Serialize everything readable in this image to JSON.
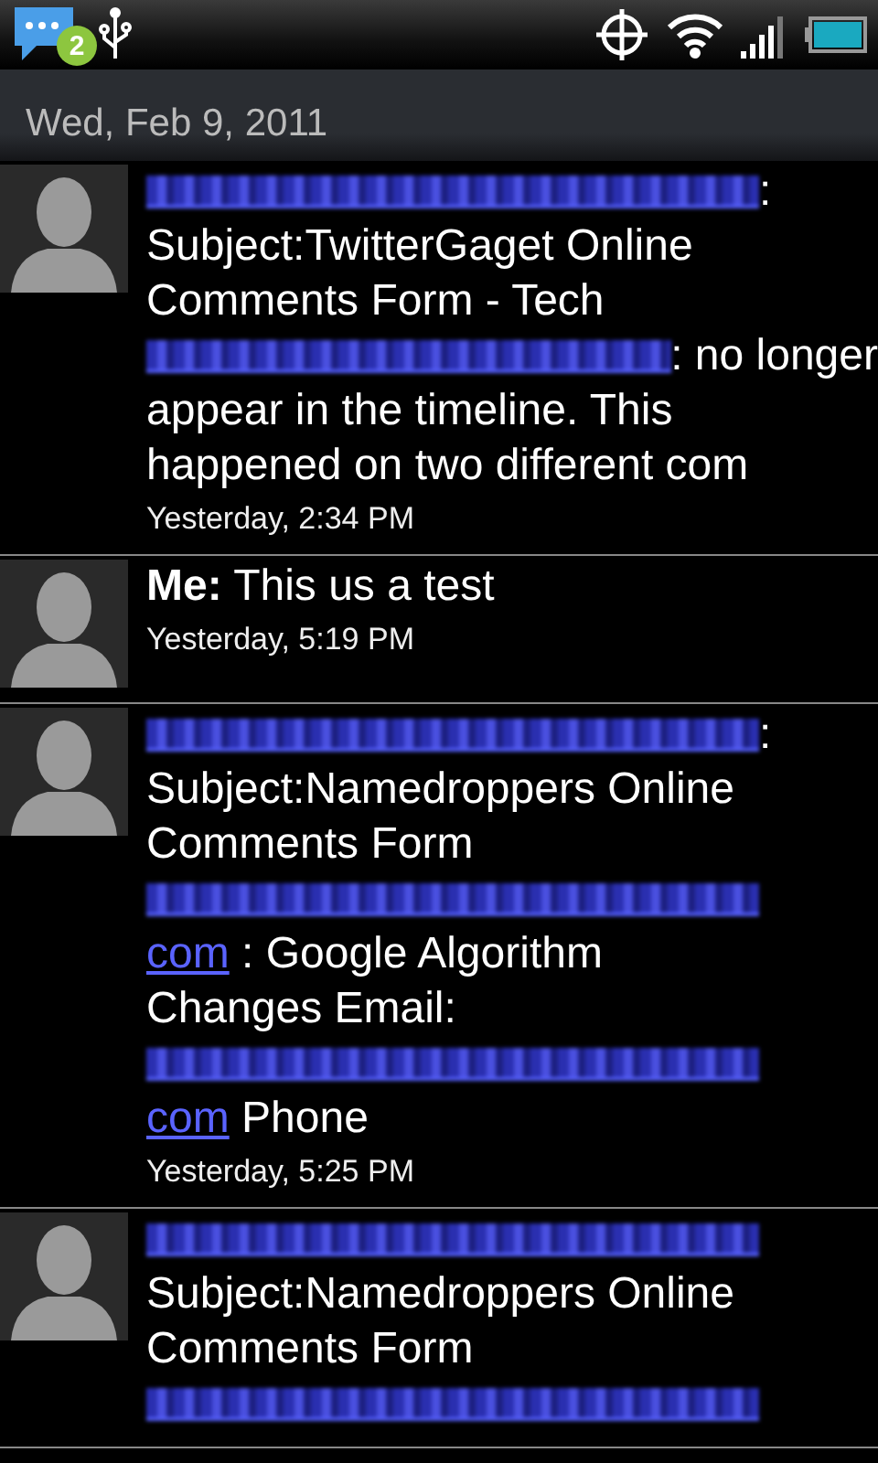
{
  "status_bar": {
    "notification_count": "2"
  },
  "date_header": "Wed, Feb 9, 2011",
  "messages": [
    {
      "lines": [
        [
          {
            "kind": "redacted"
          },
          {
            "kind": "text",
            "text": ":"
          }
        ],
        [
          {
            "kind": "text",
            "text": "Subject:TwitterGaget Online"
          }
        ],
        [
          {
            "kind": "text",
            "text": "Comments Form - Tech"
          }
        ],
        [
          {
            "kind": "redacted"
          },
          {
            "kind": "text",
            "text": ": no longer"
          }
        ],
        [
          {
            "kind": "text",
            "text": "appear in the timeline. This"
          }
        ],
        [
          {
            "kind": "text",
            "text": "happened on two different com"
          }
        ]
      ],
      "time": "Yesterday, 2:34 PM"
    },
    {
      "lines": [
        [
          {
            "kind": "text",
            "text": "**Me:** This us a test"
          }
        ]
      ],
      "time": "Yesterday, 5:19 PM"
    },
    {
      "lines": [
        [
          {
            "kind": "redacted"
          },
          {
            "kind": "text",
            "text": ":"
          }
        ],
        [
          {
            "kind": "text",
            "text": "Subject:Namedroppers Online"
          }
        ],
        [
          {
            "kind": "text",
            "text": "Comments Form"
          }
        ],
        [
          {
            "kind": "redacted"
          }
        ],
        [
          {
            "kind": "link",
            "text": "com"
          },
          {
            "kind": "text",
            "text": " : Google Algorithm"
          }
        ],
        [
          {
            "kind": "text",
            "text": "Changes Email:"
          }
        ],
        [
          {
            "kind": "redacted"
          }
        ],
        [
          {
            "kind": "link",
            "text": "com"
          },
          {
            "kind": "text",
            "text": " Phone"
          }
        ]
      ],
      "time": "Yesterday, 5:25 PM"
    },
    {
      "lines": [
        [
          {
            "kind": "redacted"
          }
        ],
        [
          {
            "kind": "text",
            "text": "Subject:Namedroppers Online"
          }
        ],
        [
          {
            "kind": "text",
            "text": "Comments Form"
          }
        ],
        [
          {
            "kind": "redacted"
          }
        ]
      ]
    }
  ]
}
